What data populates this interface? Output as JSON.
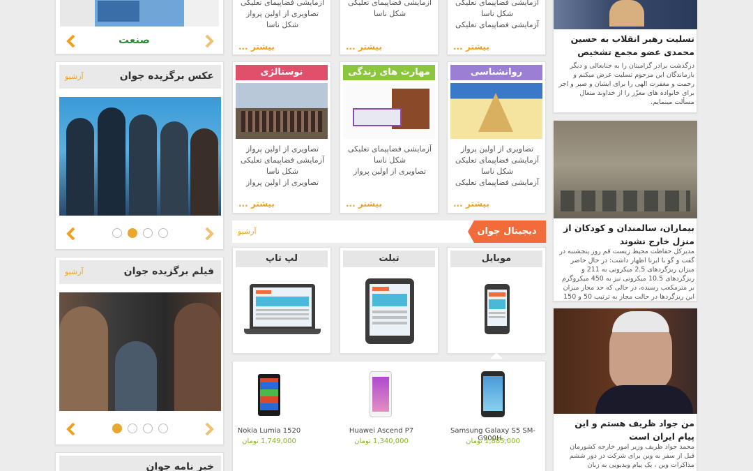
{
  "left": {
    "sanat_label": "صنعت",
    "photo_title": "عکس برگزیده جوان",
    "photo_archive": "آرشیو",
    "film_title": "فیلم برگزیده جوان",
    "film_archive": "آرشیو",
    "newsletter_title": "خبر نامه جوان"
  },
  "mid_top": {
    "col1_lines": [
      "آزمایشی فضاپیمای تعلیکی",
      "شکل ناسا",
      "آزمایشی فضاپیمای تعلیکی"
    ],
    "col2_lines": [
      "آزمایشی فضاپیمای تعلیکی",
      "شکل ناسا"
    ],
    "col3_lines": [
      "آزمایشی فضاپیمای تعلیکی",
      "تصاویری از اولین پرواز",
      "شکل ناسا"
    ],
    "more": "بیشتر ..."
  },
  "cats": [
    {
      "label": "روانشناسی",
      "color": "#9b7fd4",
      "lines": [
        "تصاویری از اولین پرواز",
        "آزمایشی فضاپیمای تعلیکی",
        "شکل ناسا",
        "آزمایشی فضاپیمای تعلیکی"
      ]
    },
    {
      "label": "مهارت های زندگی",
      "color": "#8cc63f",
      "lines": [
        "آزمایشی فضاپیمای تعلیکی",
        "شکل ناسا",
        "تصاویری از اولین پرواز"
      ]
    },
    {
      "label": "نوستالژی",
      "color": "#e0506a",
      "lines": [
        "تصاویری از اولین پرواز",
        "آزمایشی فضاپیمای تعلیکی",
        "شکل ناسا",
        "تصاویری از اولین پرواز"
      ]
    }
  ],
  "digital": {
    "title": "دیجیتال جوان",
    "archive": "آرشیو",
    "tabs": [
      "موبایل",
      "تبلت",
      "لپ تاپ"
    ],
    "products": [
      {
        "name": "Samsung Galaxy S5 SM-G900H...",
        "price": "1,885,000 تومان"
      },
      {
        "name": "Huawei Ascend P7",
        "price": "1,340,000 تومان"
      },
      {
        "name": "Nokia Lumia 1520",
        "price": "1,749,000 تومان"
      }
    ]
  },
  "right": {
    "news1_title": "تسلیت رهبر انقلاب به حسین محمدی عضو مجمع تشخیص",
    "news1_body": "درگذشت برادر گرامیتان را به جنابعالی و دیگر بازماندگان این مرحوم تسلیت عرض میکنم و رحمت و مغفرت الهی را برای ایشان و صبر و اجر برای خانواده های معزّز را از خداوند متعال مسألت مینمایم.",
    "news2_title": "بیماران، سالمندان و کودکان از منزل خارج نشوند",
    "news2_body": "مدیرکل حفاظت محیط زیست قم روز پنجشنبه در گفت و گو با ایرنا اظهار داشت: در حال حاضر میزان ریزگردهای 2.5 میکرونی به 211 و ریزگردهای 10.5 میکرونی نیز به 450 میکروگرم بر مترمکعب رسیده، در حالی که حد مجاز میزان این ریزگردها در حالت مجاز به ترتیب 50 و 150",
    "news3_title": "من جواد ظریف هستم و این پیام ایران است",
    "news3_body": "محمد جواد ظریف وزیر امور خارجه کشورمان قبل از سفر به وین برای شرکت در دور ششم مذاکرات وین ، یک پیام ویدیویی به زبان"
  },
  "colors": {
    "accent": "#f0a020",
    "digital_orange": "#f26b3a",
    "price_green": "#8ab32a"
  }
}
